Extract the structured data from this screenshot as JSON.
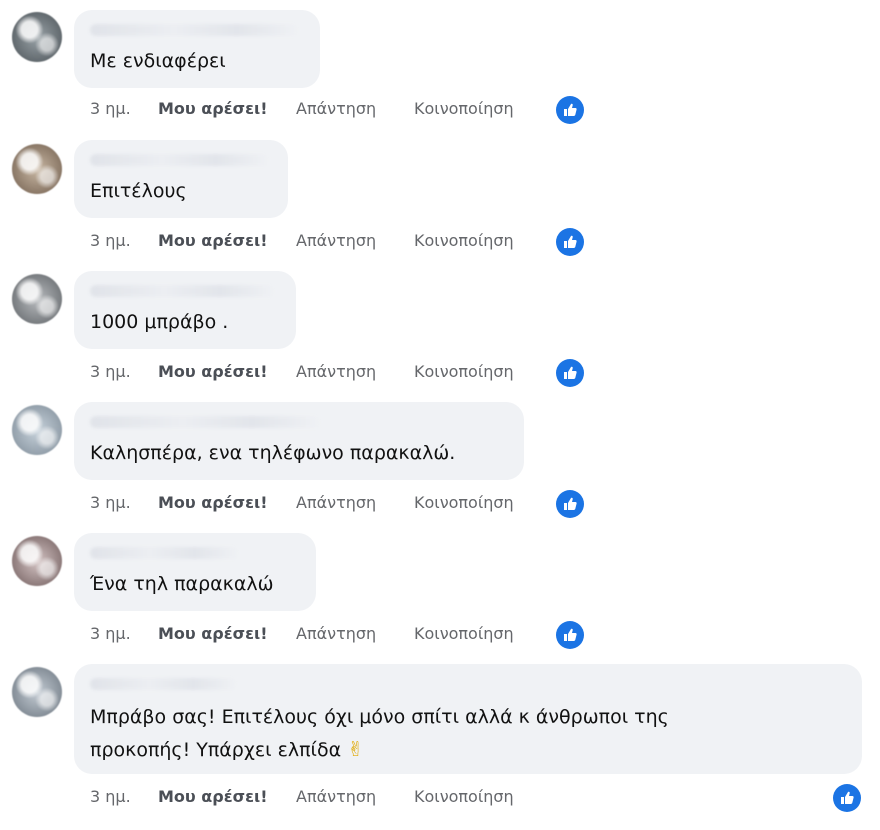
{
  "actions": {
    "time": "3 ημ.",
    "like": "Μου αρέσει!",
    "reply": "Απάντηση",
    "share": "Κοινοποίηση"
  },
  "comments": [
    {
      "author": "",
      "text": "Με ενδιαφέρει"
    },
    {
      "author": "",
      "text": "Επιτέλους"
    },
    {
      "author": "",
      "text": "1000 μπράβο ."
    },
    {
      "author": "",
      "text": "Καλησπέρα, ενα τηλέφωνο παρακαλώ."
    },
    {
      "author": "",
      "text": "Ένα τηλ παρακαλώ"
    },
    {
      "author": "",
      "text_line1": "Μπράβο σας! Επιτέλους όχι μόνο σπίτι αλλά κ άνθρωποι της",
      "text_line2": "προκοπής! Υπάρχει ελπίδα",
      "emoji": "✌"
    }
  ],
  "icons": {
    "like_badge": "thumbs-up-icon"
  },
  "colors": {
    "like_badge": "#1b74e4",
    "bubble": "#f0f2f5",
    "meta": "#65676b"
  }
}
